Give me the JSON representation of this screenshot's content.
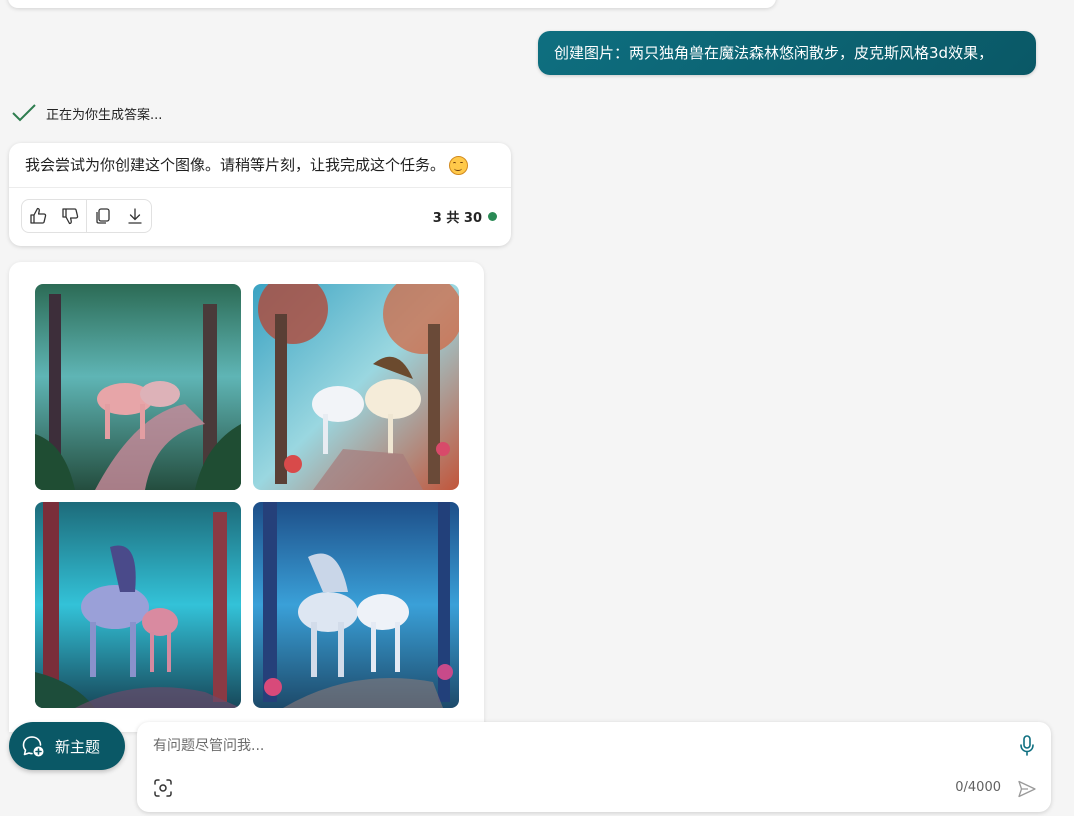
{
  "conversation": {
    "user_prompt": "创建图片：两只独角兽在魔法森林悠闲散步，皮克斯风格3d效果，",
    "status_text": "正在为你生成答案...",
    "reply_text": "我会尝试为你创建这个图像。请稍等片刻，让我完成这个任务。",
    "counter_text": "3 共 30"
  },
  "actions": {
    "icons": [
      "thumbs-up-icon",
      "thumbs-down-icon",
      "copy-icon",
      "download-icon"
    ]
  },
  "composer": {
    "new_topic_label": "新主题",
    "placeholder": "有问题尽管问我...",
    "char_count": "0/4000"
  },
  "colors": {
    "accent": "#0a5866",
    "status_dot": "#2a8a55",
    "check": "#2e7d4f",
    "page_bg": "#f5f5f5"
  }
}
